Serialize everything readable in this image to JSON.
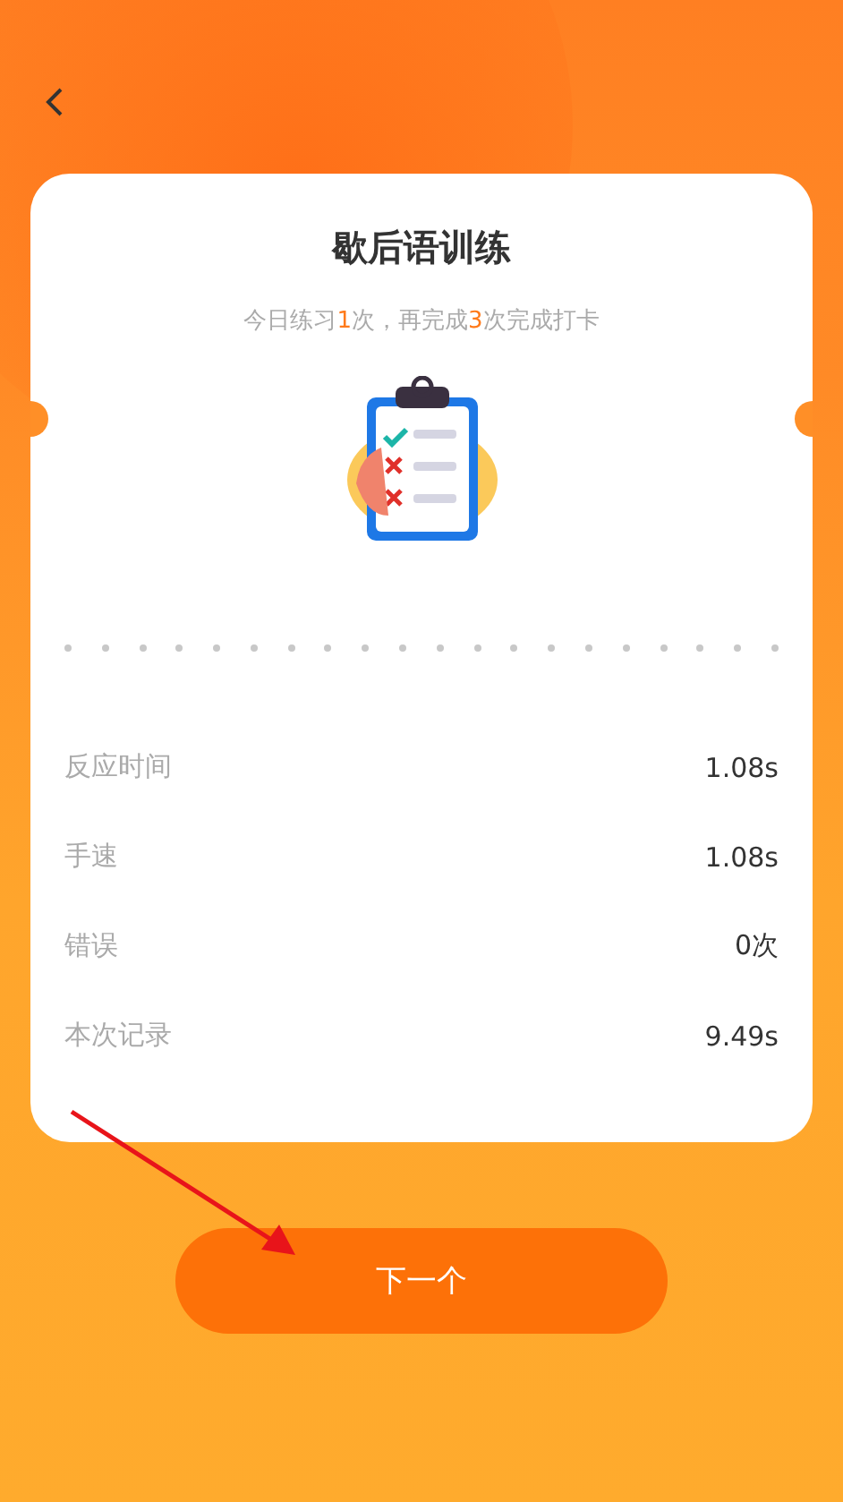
{
  "title": "歇后语训练",
  "subtitle": [
    {
      "text": "今日练习",
      "highlight": false
    },
    {
      "text": "1",
      "highlight": true
    },
    {
      "text": "次，再完成",
      "highlight": false
    },
    {
      "text": "3",
      "highlight": true
    },
    {
      "text": "次完成打卡",
      "highlight": false
    }
  ],
  "stats": [
    {
      "label": "反应时间",
      "value": "1.08s"
    },
    {
      "label": "手速",
      "value": "1.08s"
    },
    {
      "label": "错误",
      "value": "0次"
    },
    {
      "label": "本次记录",
      "value": "9.49s"
    }
  ],
  "button": "下一个"
}
